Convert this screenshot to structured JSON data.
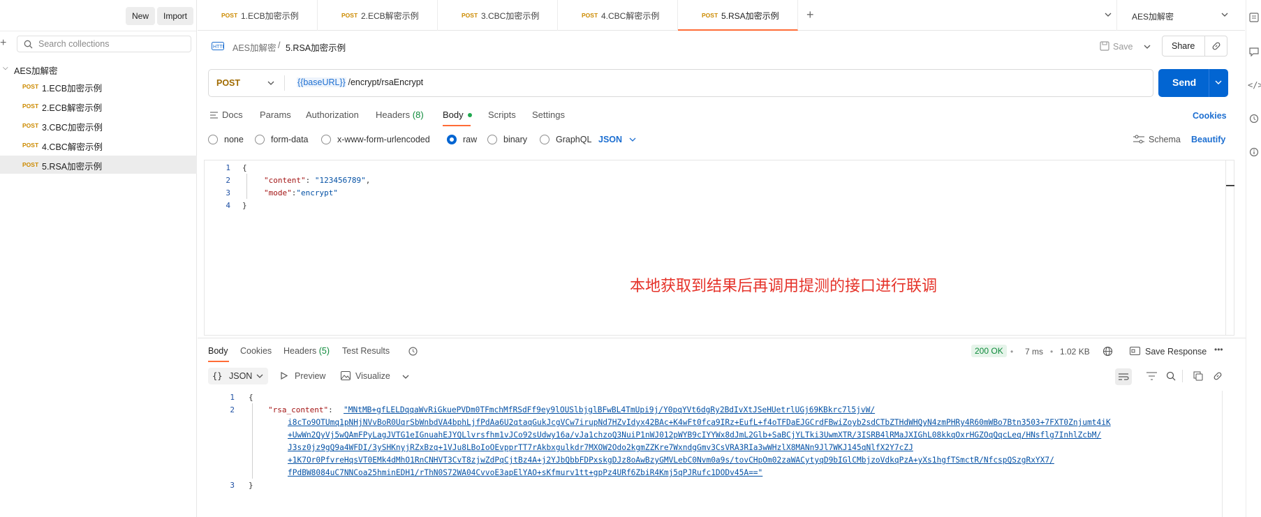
{
  "sidebar": {
    "new_label": "New",
    "import_label": "Import",
    "search_placeholder": "Search collections",
    "collection_name": "AES加解密",
    "items": [
      {
        "method": "POST",
        "label": "1.ECB加密示例"
      },
      {
        "method": "POST",
        "label": "2.ECB解密示例"
      },
      {
        "method": "POST",
        "label": "3.CBC加密示例"
      },
      {
        "method": "POST",
        "label": "4.CBC解密示例"
      },
      {
        "method": "POST",
        "label": "5.RSA加密示例"
      }
    ]
  },
  "tabs": [
    {
      "method": "POST",
      "label": "1.ECB加密示例"
    },
    {
      "method": "POST",
      "label": "2.ECB解密示例"
    },
    {
      "method": "POST",
      "label": "3.CBC加密示例"
    },
    {
      "method": "POST",
      "label": "4.CBC解密示例"
    },
    {
      "method": "POST",
      "label": "5.RSA加密示例"
    }
  ],
  "environment": "AES加解密",
  "breadcrumb": {
    "collection": "AES加解密",
    "separator": "/",
    "request": "5.RSA加密示例"
  },
  "header_actions": {
    "save": "Save",
    "share": "Share"
  },
  "request": {
    "method": "POST",
    "url_var": "{{baseURL}}",
    "url_path": " /encrypt/rsaEncrypt",
    "send": "Send"
  },
  "request_tabs": {
    "docs": "Docs",
    "params": "Params",
    "authorization": "Authorization",
    "headers": "Headers",
    "headers_count": "(8)",
    "body": "Body",
    "scripts": "Scripts",
    "settings": "Settings",
    "cookies": "Cookies"
  },
  "body_types": {
    "none": "none",
    "form_data": "form-data",
    "urlencoded": "x-www-form-urlencoded",
    "raw": "raw",
    "binary": "binary",
    "graphql": "GraphQL",
    "format": "JSON",
    "schema": "Schema",
    "beautify": "Beautify"
  },
  "editor": {
    "line_numbers": [
      "1",
      "2",
      "3",
      "4"
    ],
    "open": "{",
    "k1": "\"content\"",
    "v1": "\"123456789\"",
    "k2": "\"mode\"",
    "v2": "\"encrypt\"",
    "close": "}"
  },
  "annotation": "本地获取到结果后再调用提测的接口进行联调",
  "response": {
    "tabs": {
      "body": "Body",
      "cookies": "Cookies",
      "headers": "Headers",
      "headers_count": "(5)",
      "test_results": "Test Results"
    },
    "status": "200 OK",
    "time": "7 ms",
    "size": "1.02 KB",
    "save_response": "Save Response",
    "format": "JSON",
    "preview": "Preview",
    "visualize": "Visualize",
    "line_numbers": [
      "1",
      "2",
      "3"
    ],
    "open": "{",
    "key": "\"rsa_content\"",
    "value_lines": [
      "\"MNtMB+gfLELDqqaWvRiGkuePVDm0TFmchMfRSdFf9ey9lOUSlbjglBFwBL4TmUpi9j/Y0pqYVt6dgRy2BdIvXtJSeHUetrlUGj69KBkrc7l5jvW/",
      "i8cTo9OTUmq1pNHjNVvBoR0UqrSbWnbdVA4bphLjfPdAa6U2qtaqGukJcgVCw7irupNd7HZvIdyx42BAc+K4wFt0fca9IRz+EufL+f4oTFDaEJGCrdFBwiZoyb2sdCTbZTHdWHQyN4zmPHRy4R60mWBo7Btn3503+7FXT0Znjumt4iK",
      "+UwWn2QyVj5wQAmFPyLagJVTG1eIGnuahEJYQLlvrsfhm1vJCo92sUdwy16a/vJa1chzoQ3NuiP1nWJ012pWYB9cIYYWx8dJmL2Glb+SaBCjYLTki3UwmXTR/3ISRB4lRMaJXIGhL08kkqOxrHGZOqQqcLeq/HNsflg7InhlZcbM/",
      "J3sz0jz9gQ9a4WFDI/3ySHKnyjRZxBzq+1VJu8LBoIoOEvpprTT7rAkbxgulkdr7MXOW2Odo2kgmZZKre7WxndgGmv3CsVRA3RIa3wWHzlX8MANn9Jl7WKJ145qNlfX2Y7cZJ",
      "+1K7Or0PfvreHqsVT0EMk4dMhO1RnCNHVT3CvT8zjwZdPqCjtBz4A+j2YJbQbbFDPxskgDJz8oAwBzyGMVLebC0Nvm0a9s/tovCHpOm02zaWACytyqD9bIGlCMbjzoVdkqPzA+yXs1hgfTSmctR/NfcspQSzgRxYX7/",
      "fPdBW8084uC7NNCoa25hminEDH1/rThN0S72WA04CvvoE3apElYAO+sKfmurv1tt+gpPz4URf6ZbiR4Kmj5qPJRufc1DODv45A==\""
    ],
    "close": "}"
  }
}
